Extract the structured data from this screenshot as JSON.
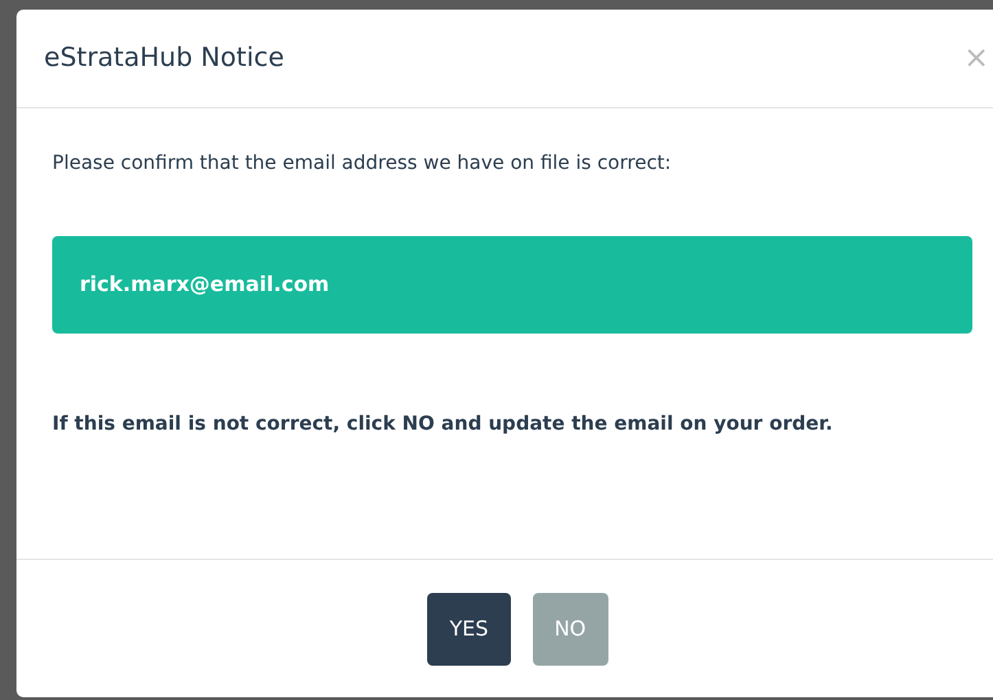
{
  "modal": {
    "title": "eStrataHub Notice",
    "close": "×"
  },
  "message": "Please confirm that the email address we have on file is correct:",
  "email": "rick.marx@email.com",
  "note": "If this email is not correct, click NO and update the email on your order.",
  "buttons": [
    {
      "label": "YES",
      "kind": "primary"
    },
    {
      "label": "NO",
      "kind": "secondary"
    }
  ]
}
